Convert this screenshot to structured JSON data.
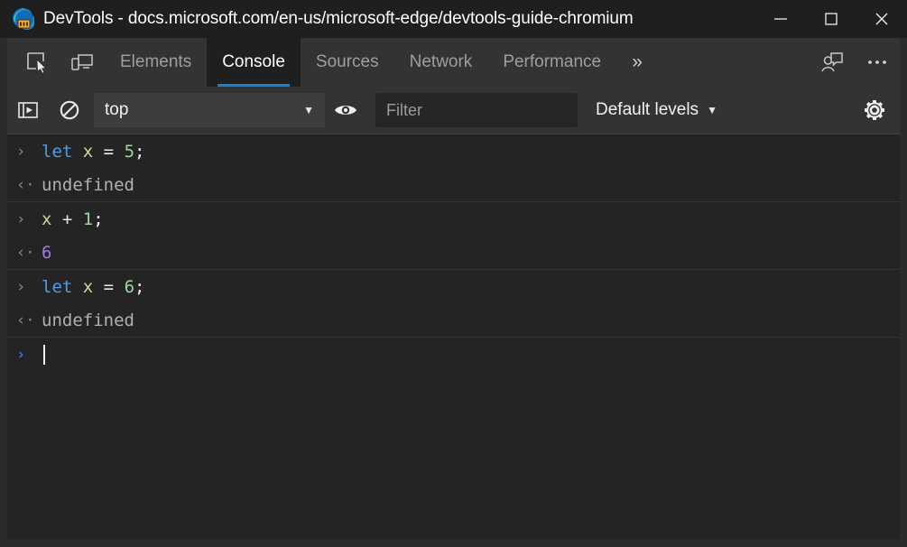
{
  "window": {
    "title": "DevTools - docs.microsoft.com/en-us/microsoft-edge/devtools-guide-chromium",
    "app_icon": "edge-devtools-icon",
    "controls": [
      {
        "name": "minimize-button",
        "icon": "minimize-icon",
        "label": "Minimize"
      },
      {
        "name": "maximize-button",
        "icon": "maximize-icon",
        "label": "Maximize"
      },
      {
        "name": "close-button",
        "icon": "close-icon",
        "label": "Close"
      }
    ],
    "colors": {
      "titlebar_bg": "#1f1f1f",
      "frame_bg": "#2b2b2b",
      "toolbar_bg": "#333333",
      "console_bg": "#242424",
      "accent": "#0a84e0"
    }
  },
  "tabbar": {
    "left_icons": [
      {
        "name": "inspect-element-icon",
        "label": "Inspect"
      },
      {
        "name": "device-emulation-icon",
        "label": "Toggle device emulation"
      }
    ],
    "tabs": [
      {
        "label": "Elements",
        "active": false
      },
      {
        "label": "Console",
        "active": true
      },
      {
        "label": "Sources",
        "active": false
      },
      {
        "label": "Network",
        "active": false
      },
      {
        "label": "Performance",
        "active": false
      }
    ],
    "more_tabs_label": "»",
    "right_icons": [
      {
        "name": "send-feedback-icon",
        "label": "Send feedback"
      },
      {
        "name": "more-options-icon",
        "label": "Customize and control DevTools"
      }
    ]
  },
  "console_toolbar": {
    "sidebar_toggle": {
      "name": "console-sidebar-toggle-icon",
      "label": "Show console sidebar"
    },
    "clear_console": {
      "name": "clear-console-icon",
      "label": "Clear console"
    },
    "context": {
      "value": "top",
      "caret": "▼",
      "label": "JavaScript context"
    },
    "live_expression": {
      "name": "eye-icon",
      "label": "Create live expression"
    },
    "filter": {
      "value": "",
      "placeholder": "Filter"
    },
    "levels": {
      "value": "Default levels",
      "caret": "▼"
    },
    "settings": {
      "name": "gear-icon",
      "label": "Console settings"
    }
  },
  "console_output": {
    "groups": [
      {
        "input": {
          "gutter": "›",
          "tokens": [
            {
              "text": "let",
              "type": "kw"
            },
            {
              "text": " ",
              "type": "op"
            },
            {
              "text": "x",
              "type": "var"
            },
            {
              "text": " ",
              "type": "op"
            },
            {
              "text": "=",
              "type": "op"
            },
            {
              "text": " ",
              "type": "op"
            },
            {
              "text": "5",
              "type": "num"
            },
            {
              "text": ";",
              "type": "punc"
            }
          ],
          "plain": "let x = 5;"
        },
        "output": {
          "gutter": "‹·",
          "text": "undefined",
          "kind": "undefined"
        }
      },
      {
        "input": {
          "gutter": "›",
          "tokens": [
            {
              "text": "x",
              "type": "var"
            },
            {
              "text": " ",
              "type": "op"
            },
            {
              "text": "+",
              "type": "op"
            },
            {
              "text": " ",
              "type": "op"
            },
            {
              "text": "1",
              "type": "num"
            },
            {
              "text": ";",
              "type": "punc"
            }
          ],
          "plain": "x + 1;"
        },
        "output": {
          "gutter": "‹·",
          "text": "6",
          "kind": "number"
        }
      },
      {
        "input": {
          "gutter": "›",
          "tokens": [
            {
              "text": "let",
              "type": "kw"
            },
            {
              "text": " ",
              "type": "op"
            },
            {
              "text": "x",
              "type": "var"
            },
            {
              "text": " ",
              "type": "op"
            },
            {
              "text": "=",
              "type": "op"
            },
            {
              "text": " ",
              "type": "op"
            },
            {
              "text": "6",
              "type": "num"
            },
            {
              "text": ";",
              "type": "punc"
            }
          ],
          "plain": "let x = 6;"
        },
        "output": {
          "gutter": "‹·",
          "text": "undefined",
          "kind": "undefined"
        }
      }
    ],
    "prompt": {
      "gutter": "›",
      "value": ""
    }
  }
}
